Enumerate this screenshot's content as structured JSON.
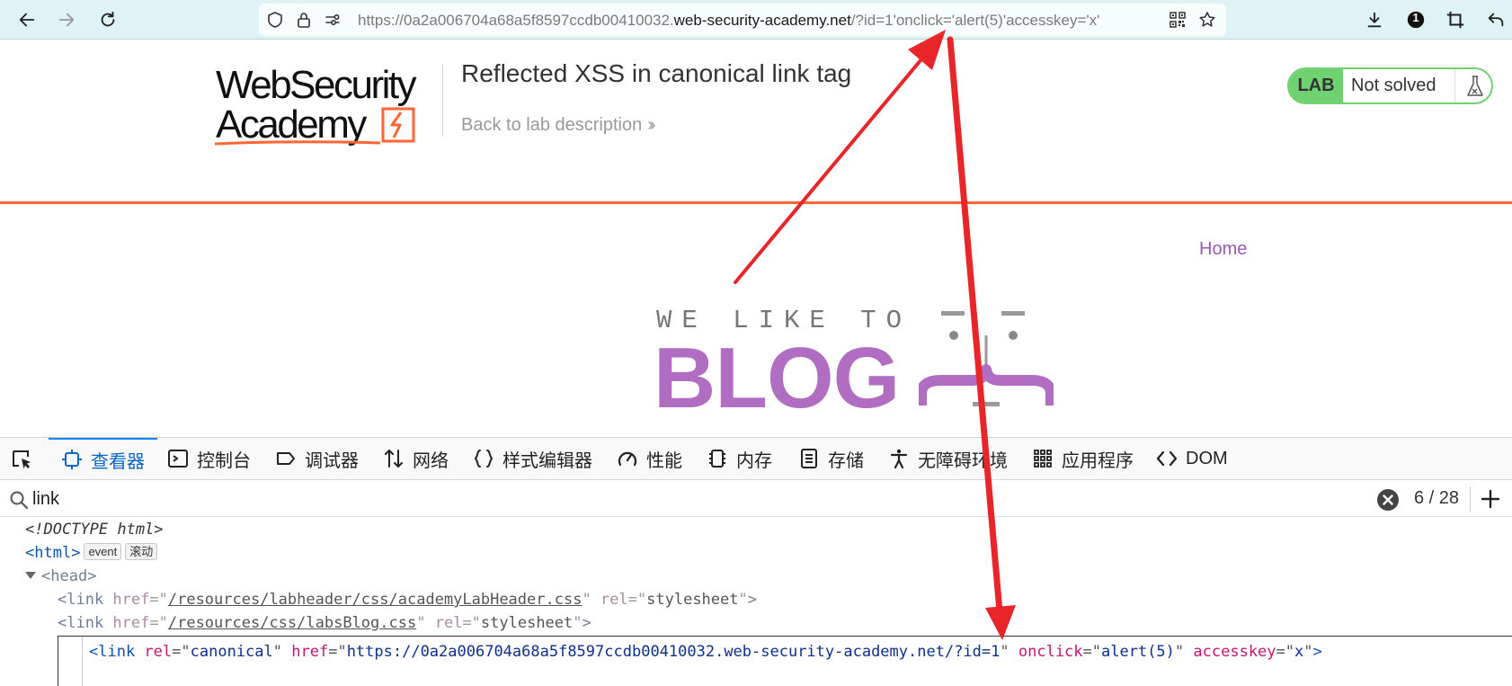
{
  "browser": {
    "url_prefix": "https://0a2a006704a68a5f8597ccdb00410032.",
    "url_domain": "web-security-academy.net",
    "url_suffix": "/?id=1'onclick='alert(5)'accesskey='x'",
    "notification_count": "1"
  },
  "lab_header": {
    "logo_line1": "WebSecurity",
    "logo_line2": "Academy",
    "title": "Reflected XSS in canonical link tag",
    "back_link": "Back to lab description",
    "badge_label": "LAB",
    "badge_status": "Not solved"
  },
  "blog": {
    "nav_home": "Home",
    "logo_top": "WE LIKE TO",
    "logo_big": "BLOG"
  },
  "devtools": {
    "tabs": [
      {
        "label": "查看器",
        "icon": "inspector-icon"
      },
      {
        "label": "控制台",
        "icon": "console-icon"
      },
      {
        "label": "调试器",
        "icon": "debugger-icon"
      },
      {
        "label": "网络",
        "icon": "network-icon"
      },
      {
        "label": "样式编辑器",
        "icon": "style-editor-icon"
      },
      {
        "label": "性能",
        "icon": "performance-icon"
      },
      {
        "label": "内存",
        "icon": "memory-icon"
      },
      {
        "label": "存储",
        "icon": "storage-icon"
      },
      {
        "label": "无障碍环境",
        "icon": "accessibility-icon"
      },
      {
        "label": "应用程序",
        "icon": "application-icon"
      },
      {
        "label": "DOM",
        "icon": "dom-icon"
      }
    ],
    "search_value": "link",
    "search_count": "6 / 28",
    "tree": {
      "doctype": "<!DOCTYPE html>",
      "html_tag": "html",
      "badge_event": "event",
      "badge_scroll": "滚动",
      "head_tag": "head",
      "link1_href": "/resources/labheader/css/academyLabHeader.css",
      "link2_href": "/resources/css/labsBlog.css",
      "rel_stylesheet": "stylesheet",
      "canonical_rel": "canonical",
      "canonical_href": "https://0a2a006704a68a5f8597ccdb00410032.web-security-academy.net/?id=1",
      "onclick_value": "alert(5)",
      "accesskey_value": "x"
    }
  },
  "colors": {
    "accent_orange": "#ff6633",
    "lab_green": "#70d170",
    "blog_purple": "#b06dc1",
    "annotation_red": "#e8262a"
  }
}
